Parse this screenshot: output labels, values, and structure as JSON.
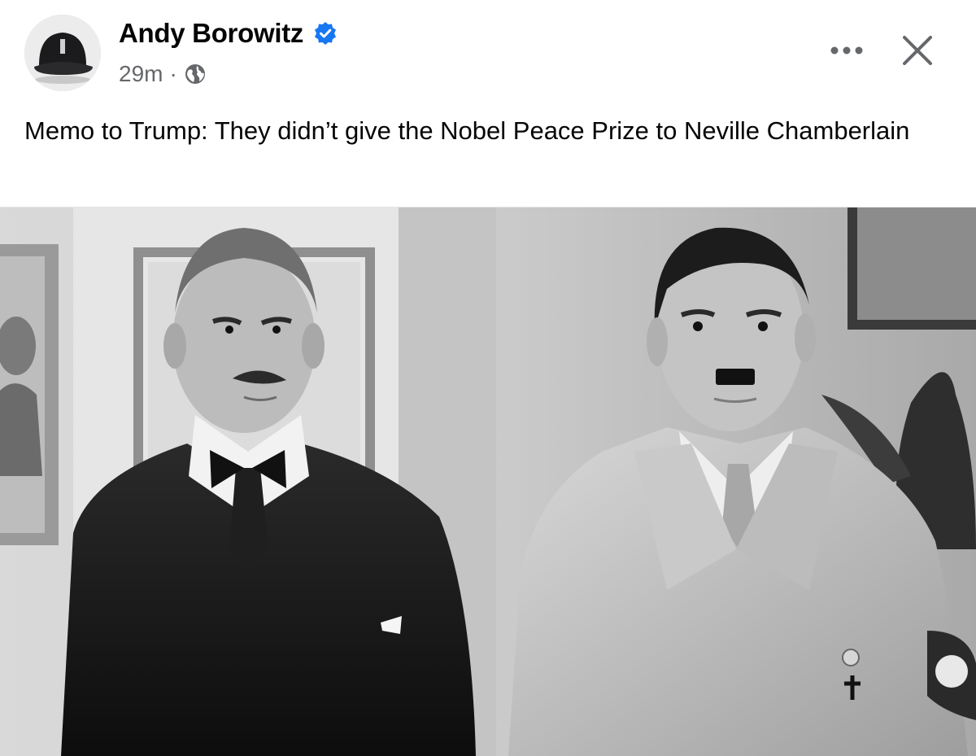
{
  "post": {
    "author": "Andy Borowitz",
    "time": "29m",
    "separator": "·",
    "text": "Memo to Trump: They didn’t give the Nobel Peace Prize to Neville Chamberlain",
    "photo_alt": "Black and white photo of Neville Chamberlain and Adolf Hitler"
  },
  "icons": {
    "verified": "verified-badge-icon",
    "audience": "globe-icon",
    "more": "more-options-icon",
    "close": "close-icon"
  },
  "colors": {
    "verified_blue": "#1877f2",
    "text_primary": "#050505",
    "text_secondary": "#65676b"
  }
}
